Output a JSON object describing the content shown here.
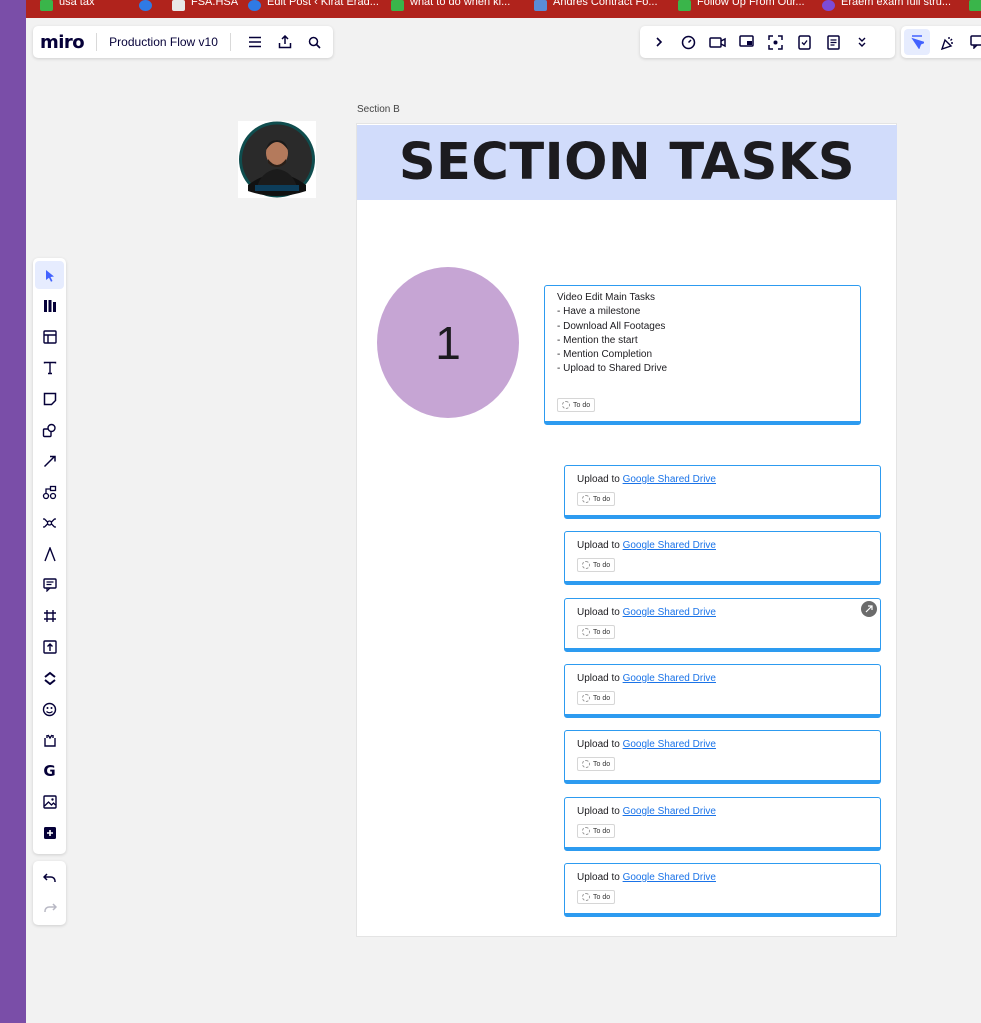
{
  "browser": {
    "bookmarks": [
      {
        "label": "usa tax",
        "color": "#2f7ae5"
      },
      {
        "label": "",
        "color": "#2f7ae5"
      },
      {
        "label": "FSA.HSA",
        "color": "#e8e8e8"
      },
      {
        "label": "Edit Post ‹ Kirat Erad...",
        "color": "#2f7ae5"
      },
      {
        "label": "what to do when ki...",
        "color": "#3ab54a"
      },
      {
        "label": "Andres Contract Fo...",
        "color": "#5a8bd6"
      },
      {
        "label": "Follow Up From Our...",
        "color": "#3ab54a"
      },
      {
        "label": "Eraem exam full stru...",
        "color": "#7c4bd6"
      }
    ]
  },
  "toolbar": {
    "logo": "miro",
    "board_name": "Production Flow v10",
    "icons": [
      "menu-icon",
      "export-icon",
      "search-icon"
    ]
  },
  "top_right_icons": [
    "chevron-right-icon",
    "timer-icon",
    "video-call-icon",
    "presentation-icon",
    "focus-icon",
    "voting-icon",
    "notes-icon",
    "more-icon"
  ],
  "top_right2_icons": [
    "select-mode-icon",
    "celebrate-icon",
    "comment-icon"
  ],
  "left_tools": [
    "select-icon",
    "library-icon",
    "templates-icon",
    "text-icon",
    "sticky-note-icon",
    "shapes-icon",
    "connector-icon",
    "diagram-icon",
    "mindmap-icon",
    "pen-icon",
    "comment-icon",
    "frame-icon",
    "upload-icon",
    "clickup-icon",
    "emoji-icon",
    "integration-icon",
    "google-icon",
    "image-icon",
    "more-apps-icon"
  ],
  "undo_redo": [
    "undo-icon",
    "redo-icon"
  ],
  "section": {
    "label": "Section B",
    "title": "SECTION TASKS",
    "circle_number": "1",
    "main_card": {
      "lines": [
        "Video Edit Main Tasks",
        "- Have a milestone",
        "- Download All Footages",
        "- Mention the start",
        "- Mention Completion",
        "- Upload to Shared Drive"
      ],
      "status": "To do"
    },
    "upload_cards": [
      {
        "prefix": "Upload to",
        "link": "Google Shared Drive",
        "status": "To do"
      },
      {
        "prefix": "Upload to",
        "link": "Google Shared Drive",
        "status": "To do"
      },
      {
        "prefix": "Upload to",
        "link": "Google Shared Drive",
        "status": "To do"
      },
      {
        "prefix": "Upload to",
        "link": "Google Shared Drive",
        "status": "To do"
      },
      {
        "prefix": "Upload to",
        "link": "Google Shared Drive",
        "status": "To do"
      },
      {
        "prefix": "Upload to",
        "link": "Google Shared Drive",
        "status": "To do"
      },
      {
        "prefix": "Upload to",
        "link": "Google Shared Drive",
        "status": "To do"
      }
    ]
  },
  "colors": {
    "section_header": "#d1dcfb",
    "circle": "#c6a5d4",
    "card_border": "#2d9bf0",
    "link": "#1a73e8",
    "bookmarks_bar": "#b0231c",
    "os_strip": "#7a4ea8"
  }
}
